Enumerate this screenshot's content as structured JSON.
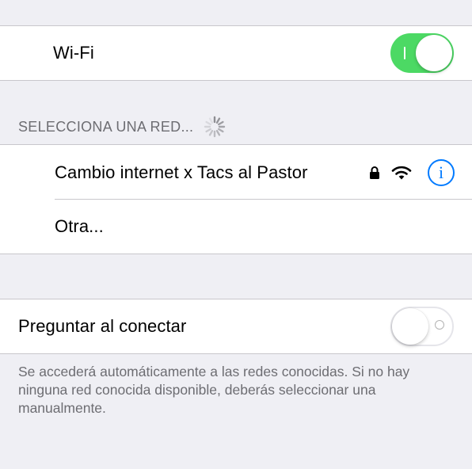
{
  "wifi": {
    "label": "Wi-Fi",
    "enabled": true
  },
  "networks_section": {
    "header": "SELECCIONA UNA RED...",
    "items": [
      {
        "name": "Cambio internet x Tacs al Pastor",
        "secured": true,
        "icons": [
          "lock-icon",
          "wifi-signal-icon",
          "info-icon"
        ],
        "info_glyph": "i"
      },
      {
        "name": "Otra..."
      }
    ]
  },
  "ask_to_join": {
    "label": "Preguntar al conectar",
    "enabled": false
  },
  "footer": {
    "text": "Se accederá automáticamente a las redes conocidas. Si no hay ninguna red conocida disponible, deberás seleccionar una manualmente."
  },
  "colors": {
    "background": "#efeff4",
    "switch_on": "#4cd964",
    "accent_blue": "#007aff",
    "secondary_text": "#6d6d72",
    "separator": "#c8c7cc"
  }
}
